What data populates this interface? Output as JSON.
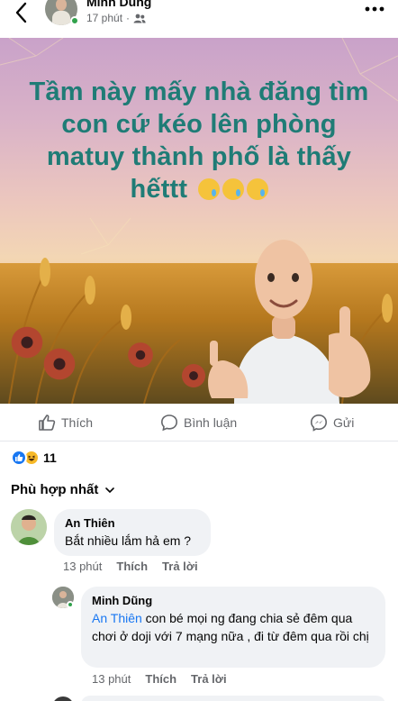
{
  "header": {
    "author": "Minh Dũng",
    "time": "17 phút",
    "separator": "·"
  },
  "post": {
    "image_text": "Tầm này mấy nhà đăng tìm con cứ kéo lên phòng matuy thành phố là thấy hếttt",
    "emoji_count": 3
  },
  "actions": {
    "like": "Thích",
    "comment": "Bình luận",
    "share": "Gửi"
  },
  "reactions": {
    "count": "11"
  },
  "sort": {
    "label": "Phù hợp nhất"
  },
  "comments": [
    {
      "author": "An Thiên",
      "text": "Bắt nhiều lắm hả em ?",
      "time": "13 phút",
      "like": "Thích",
      "reply": "Trả lời"
    },
    {
      "author": "Minh Dũng",
      "mention": "An Thiên",
      "text": " con bé mọi ng đang chia sẻ đêm qua chơi ở doji với 7 mạng nữa , đi từ đêm qua rồi chị",
      "time": "13 phút",
      "like": "Thích",
      "reply": "Trả lời"
    }
  ],
  "colors": {
    "accent": "#1877f2",
    "online": "#31a24c",
    "hero_text": "#1f7c76"
  }
}
